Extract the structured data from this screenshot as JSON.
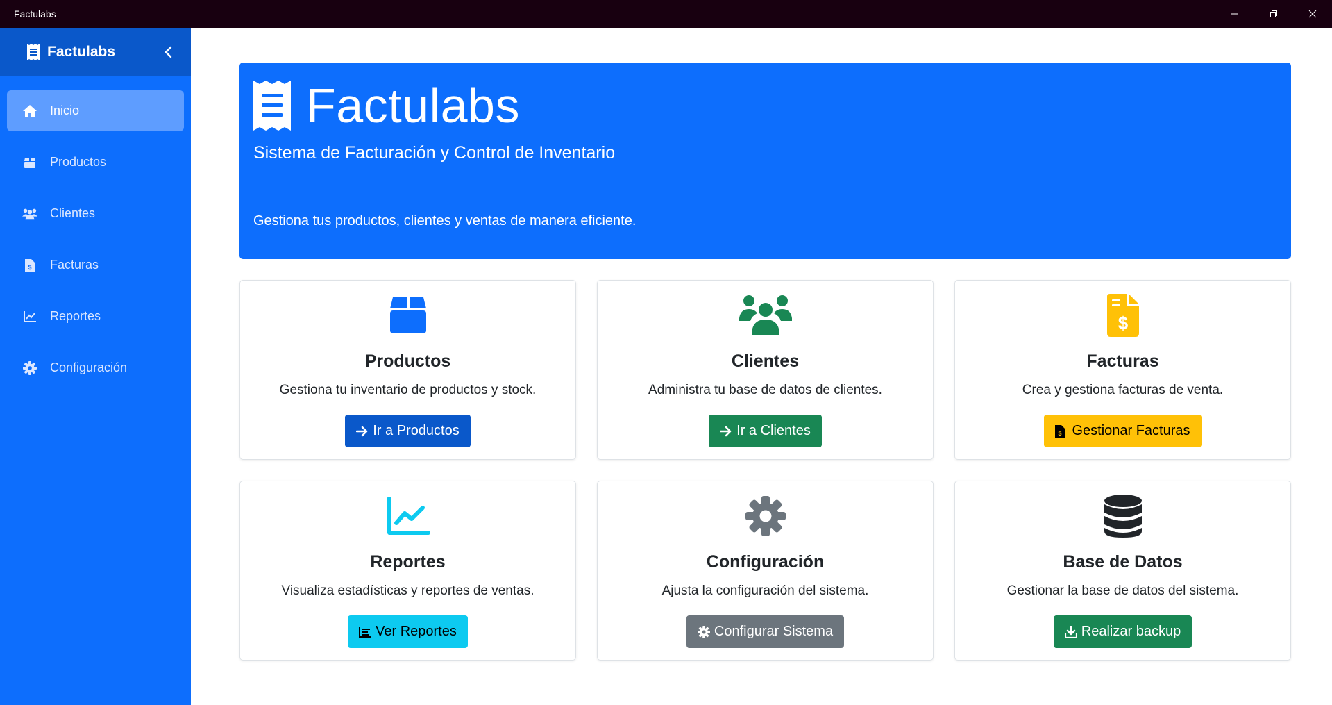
{
  "window": {
    "title": "Factulabs"
  },
  "sidebar": {
    "brand": "Factulabs",
    "items": [
      {
        "label": "Inicio",
        "icon": "home-icon",
        "active": true
      },
      {
        "label": "Productos",
        "icon": "box-icon"
      },
      {
        "label": "Clientes",
        "icon": "users-icon"
      },
      {
        "label": "Facturas",
        "icon": "invoice-icon"
      },
      {
        "label": "Reportes",
        "icon": "chart-line-icon"
      },
      {
        "label": "Configuración",
        "icon": "gear-icon"
      }
    ]
  },
  "hero": {
    "title": "Factulabs",
    "subtitle": "Sistema de Facturación y Control de Inventario",
    "lead": "Gestiona tus productos, clientes y ventas de manera eficiente."
  },
  "cards": [
    {
      "title": "Productos",
      "text": "Gestiona tu inventario de productos y stock.",
      "button": "Ir a Productos",
      "icon": "box-icon",
      "color": "#0d6efd"
    },
    {
      "title": "Clientes",
      "text": "Administra tu base de datos de clientes.",
      "button": "Ir a Clientes",
      "icon": "users-icon",
      "color": "#198754"
    },
    {
      "title": "Facturas",
      "text": "Crea y gestiona facturas de venta.",
      "button": "Gestionar Facturas",
      "icon": "invoice-icon",
      "color": "#ffc107"
    },
    {
      "title": "Reportes",
      "text": "Visualiza estadísticas y reportes de ventas.",
      "button": "Ver Reportes",
      "icon": "chart-line-icon",
      "color": "#0dcaf0"
    },
    {
      "title": "Configuración",
      "text": "Ajusta la configuración del sistema.",
      "button": "Configurar Sistema",
      "icon": "gear-icon",
      "color": "#6c757d"
    },
    {
      "title": "Base de Datos",
      "text": "Gestionar la base de datos del sistema.",
      "button": "Realizar backup",
      "icon": "database-icon",
      "color": "#212529"
    }
  ],
  "colors": {
    "sidebar": "#0d6efd",
    "sidebar_header": "#0a58ca",
    "active_item": "#5e9dff",
    "hero": "#0d6efd"
  }
}
